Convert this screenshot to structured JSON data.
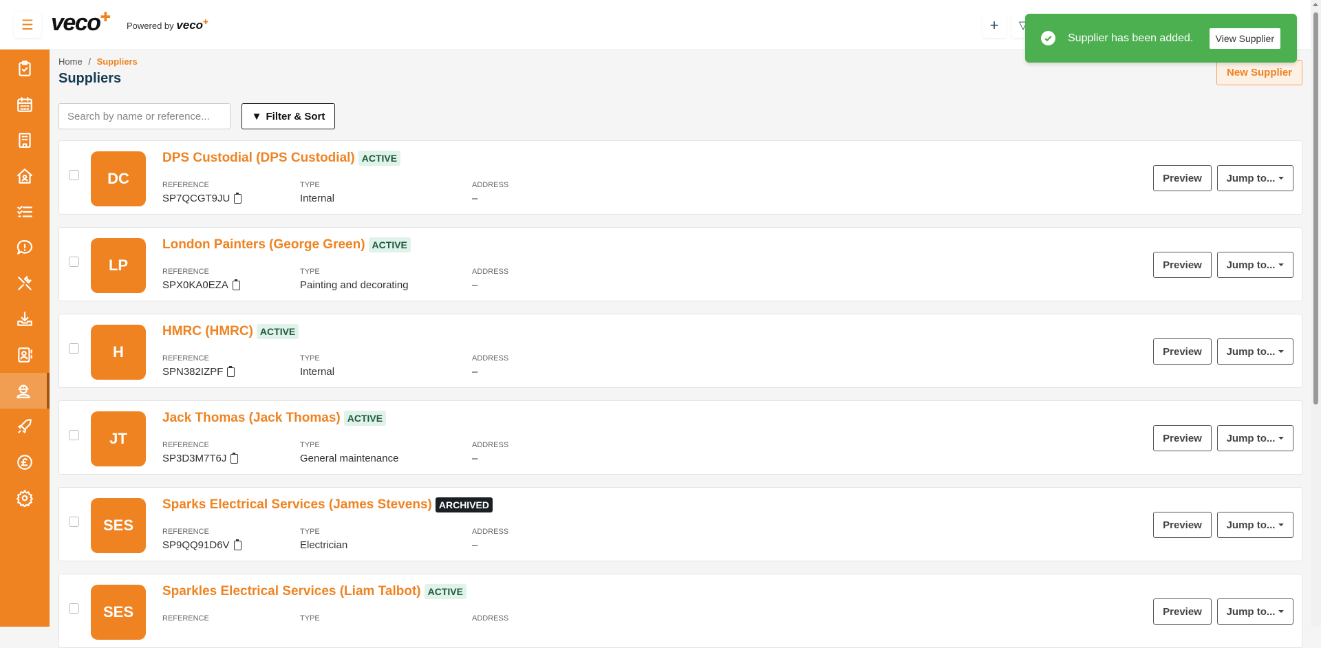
{
  "header": {
    "logo": "veco",
    "powered_by": "Powered by",
    "powered_logo": "veco"
  },
  "breadcrumb": {
    "home": "Home",
    "separator": "/",
    "current": "Suppliers"
  },
  "page_title": "Suppliers",
  "search": {
    "placeholder": "Search by name or reference...",
    "value": ""
  },
  "filter_label": "Filter & Sort",
  "new_supplier_label": "New Supplier",
  "toast": {
    "message": "Supplier has been added.",
    "action": "View Supplier",
    "color": "#4caf50"
  },
  "labels": {
    "reference": "Reference",
    "type": "Type",
    "address": "Address",
    "preview": "Preview",
    "jump": "Jump to..."
  },
  "sidebar": [
    "tasks",
    "calendar",
    "buildings",
    "properties",
    "checklists",
    "issues",
    "maintenance",
    "downloads",
    "contacts",
    "suppliers",
    "projects",
    "finance",
    "settings"
  ],
  "suppliers": [
    {
      "initials": "DC",
      "name": "DPS Custodial (DPS Custodial)",
      "status": "ACTIVE",
      "reference": "SP7QCGT9JU",
      "type": "Internal",
      "address": "–"
    },
    {
      "initials": "LP",
      "name": "London Painters (George Green)",
      "status": "ACTIVE",
      "reference": "SPX0KA0EZA",
      "type": "Painting and decorating",
      "address": "–"
    },
    {
      "initials": "H",
      "name": "HMRC (HMRC)",
      "status": "ACTIVE",
      "reference": "SPN382IZPF",
      "type": "Internal",
      "address": "–"
    },
    {
      "initials": "JT",
      "name": "Jack Thomas (Jack Thomas)",
      "status": "ACTIVE",
      "reference": "SP3D3M7T6J",
      "type": "General maintenance",
      "address": "–"
    },
    {
      "initials": "SES",
      "name": "Sparks Electrical Services (James Stevens)",
      "status": "ARCHIVED",
      "reference": "SP9QQ91D6V",
      "type": "Electrician",
      "address": "–"
    },
    {
      "initials": "SES",
      "name": "Sparkles Electrical Services (Liam Talbot)",
      "status": "ACTIVE",
      "reference": "",
      "type": "",
      "address": ""
    }
  ]
}
